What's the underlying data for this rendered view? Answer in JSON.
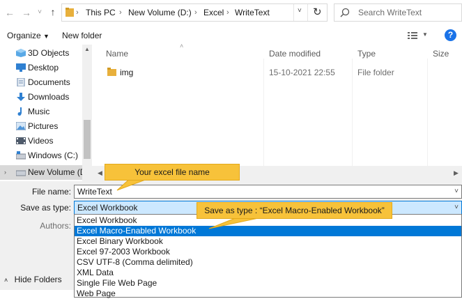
{
  "address_bar": {
    "path": [
      "This PC",
      "New Volume (D:)",
      "Excel",
      "WriteText"
    ],
    "search_placeholder": "Search WriteText"
  },
  "toolbar": {
    "organize_label": "Organize",
    "new_folder_label": "New folder"
  },
  "nav": {
    "items": [
      {
        "label": "3D Objects",
        "icon": "cube-icon"
      },
      {
        "label": "Desktop",
        "icon": "desktop-icon"
      },
      {
        "label": "Documents",
        "icon": "documents-icon"
      },
      {
        "label": "Downloads",
        "icon": "downloads-icon"
      },
      {
        "label": "Music",
        "icon": "music-icon"
      },
      {
        "label": "Pictures",
        "icon": "pictures-icon"
      },
      {
        "label": "Videos",
        "icon": "videos-icon"
      },
      {
        "label": "Windows (C:)",
        "icon": "drive-icon"
      },
      {
        "label": "New Volume (D:",
        "icon": "drive-icon",
        "selected": true
      }
    ]
  },
  "file_list": {
    "columns": [
      "Name",
      "Date modified",
      "Type",
      "Size"
    ],
    "rows": [
      {
        "name": "img",
        "date": "15-10-2021 22:55",
        "type": "File folder"
      }
    ]
  },
  "form": {
    "filename_label": "File name:",
    "filename_value": "WriteText",
    "saveas_label": "Save as type:",
    "saveas_value": "Excel Workbook",
    "authors_label": "Authors:",
    "hide_folders_label": "Hide Folders"
  },
  "dropdown": {
    "options": [
      "Excel Workbook",
      "Excel Macro-Enabled Workbook",
      "Excel Binary Workbook",
      "Excel 97-2003 Workbook",
      "CSV UTF-8 (Comma delimited)",
      "XML Data",
      "Single File Web Page",
      "Web Page"
    ],
    "highlighted_index": 1
  },
  "callouts": {
    "filename_note": "Your excel file name",
    "saveas_note": "Save as type : “Excel Macro-Enabled Workbook”"
  },
  "colors": {
    "selection": "#0078d7",
    "callout": "#f7c23a",
    "folder": "#e8b03c",
    "help": "#1a73e8"
  }
}
